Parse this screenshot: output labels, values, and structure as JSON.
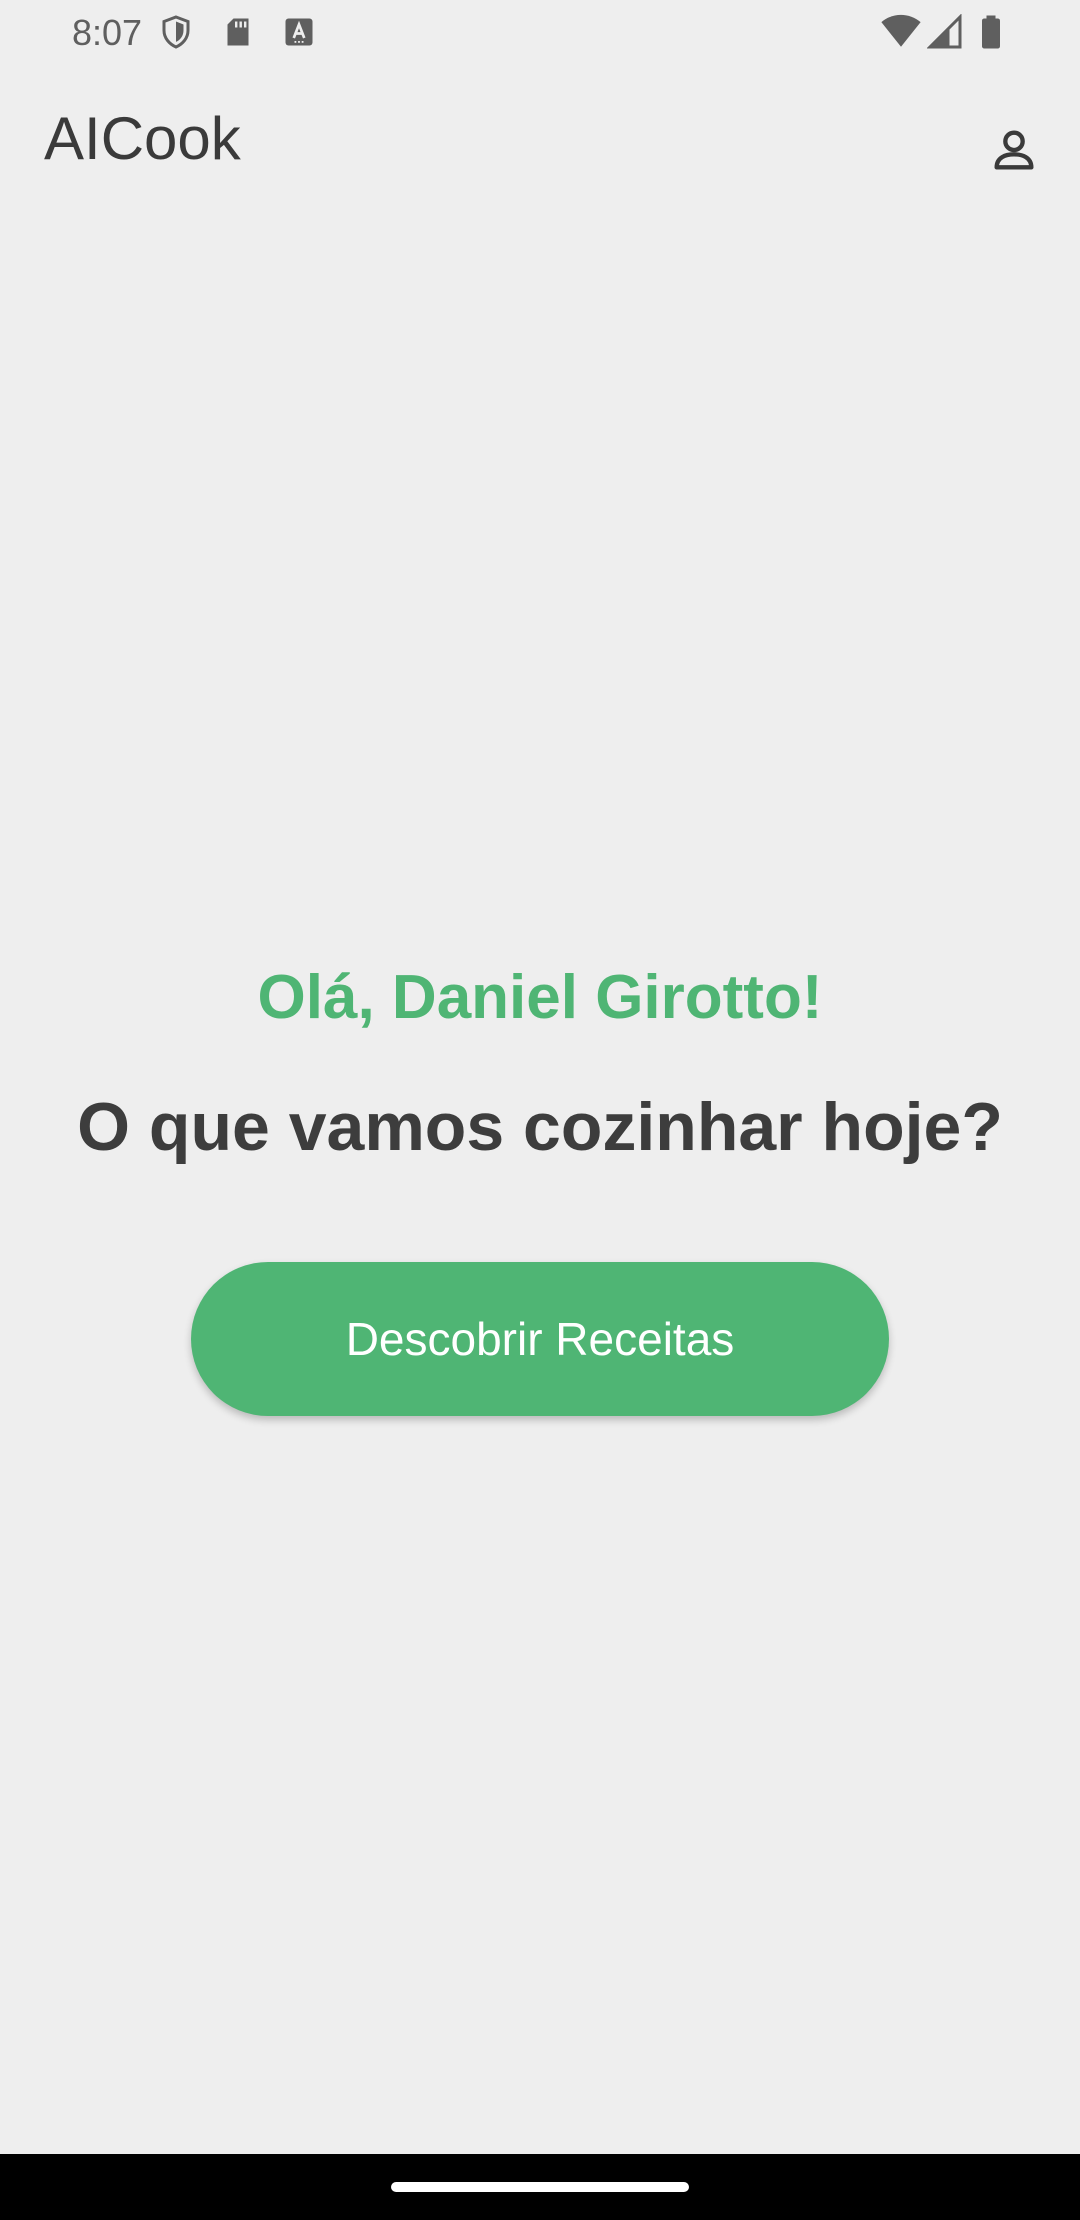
{
  "status_bar": {
    "time": "8:07",
    "left_icons": [
      "shield-icon",
      "sd-card-icon",
      "keyboard-a-icon"
    ],
    "right_icons": [
      "wifi-icon",
      "cell-signal-icon",
      "battery-icon"
    ]
  },
  "app_bar": {
    "title": "AICook",
    "profile_icon": "person-icon"
  },
  "main": {
    "greeting": "Olá, Daniel Girotto!",
    "question": "O que vamos cozinhar hoje?",
    "discover_button_label": "Descobrir Receitas"
  },
  "colors": {
    "background": "#eeeeee",
    "accent": "#4fb574",
    "text_primary": "#3d3d3d",
    "nav_bar": "#000000"
  }
}
